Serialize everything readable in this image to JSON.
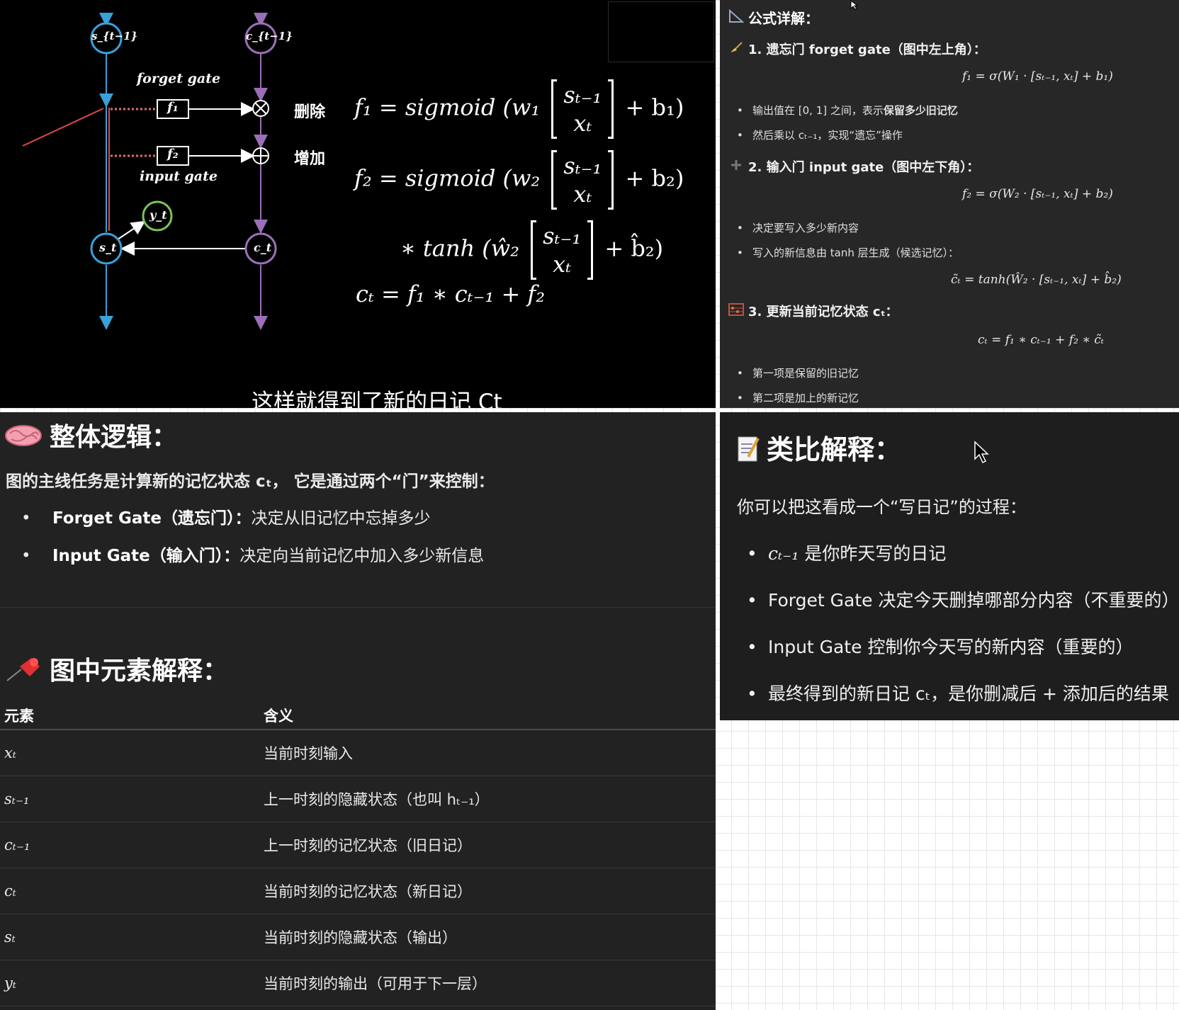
{
  "video": {
    "diagram": {
      "node_s_prev": "s_{t−1}",
      "node_c_prev": "c_{t−1}",
      "node_s": "s_t",
      "node_c": "c_t",
      "node_y": "y_t",
      "box_f1": "f₁",
      "box_f2": "f₂",
      "forget_gate": "forget gate",
      "input_gate": "input gate",
      "op_delete": "删除",
      "op_add": "增加"
    },
    "equations": {
      "eq1_lhs": "f₁ = sigmoid (w₁",
      "eq1_rhs": "+ b₁)",
      "eq2_lhs": "f₂ = sigmoid (w₂",
      "eq2_rhs": "+ b₂)",
      "eq3_lhs": "∗ tanh (ŵ₂",
      "eq3_rhs": "+ b̂₂)",
      "eq4": "cₜ = f₁ ∗ cₜ₋₁ + f₂",
      "mat_top": "sₜ₋₁",
      "mat_bottom": "xₜ"
    },
    "caption": "这样就得到了新的日记 Ct"
  },
  "formula_panel": {
    "title": "公式详解：",
    "title_icon": "triangle-ruler-icon",
    "sec1_icon": "broom-icon",
    "sec1_title": "1. 遗忘门 forget gate（图中左上角）：",
    "sec1_formula": "f₁ = σ(W₁ · [sₜ₋₁, xₜ] + b₁)",
    "sec1_b1_pre": "输出值在 [0, 1] 之间，表示",
    "sec1_b1_bold": "保留多少旧记忆",
    "sec1_b2": "然后乘以 cₜ₋₁，实现“遗忘”操作",
    "sec2_icon": "plus-icon",
    "sec2_title": "2. 输入门 input gate（图中左下角）：",
    "sec2_formula": "f₂ = σ(W₂ · [sₜ₋₁, xₜ] + b₂)",
    "sec2_b1": "决定要写入多少新内容",
    "sec2_b2": "写入的新信息由 tanh 层生成（候选记忆）：",
    "sec2_formula2": "c̃ₜ = tanh(Ŵ₂ · [sₜ₋₁, xₜ] + b̂₂)",
    "sec3_icon": "abacus-icon",
    "sec3_title": "3. 更新当前记忆状态 cₜ：",
    "sec3_formula": "cₜ = f₁ ∗ cₜ₋₁ + f₂ ∗ c̃ₜ",
    "sec3_b1": "第一项是保留的旧记忆",
    "sec3_b2": "第二项是加上的新记忆"
  },
  "logic_panel": {
    "title": "整体逻辑：",
    "title_icon": "brain-icon",
    "intro": "图的主线任务是计算新的记忆状态 cₜ，  它是通过两个“门”来控制：",
    "items": [
      {
        "bold": "Forget Gate（遗忘门）：",
        "text": "决定从旧记忆中忘掉多少"
      },
      {
        "bold": "Input Gate（输入门）：",
        "text": "决定向当前记忆中加入多少新信息"
      }
    ],
    "elements_title": "图中元素解释：",
    "elements_icon": "pushpin-icon",
    "table_header": [
      "元素",
      "含义"
    ],
    "table_rows": [
      {
        "sym": "xₜ",
        "meaning": "当前时刻输入"
      },
      {
        "sym": "sₜ₋₁",
        "meaning": "上一时刻的隐藏状态（也叫 hₜ₋₁）"
      },
      {
        "sym": "cₜ₋₁",
        "meaning": "上一时刻的记忆状态（旧日记）"
      },
      {
        "sym": "cₜ",
        "meaning": "当前时刻的记忆状态（新日记）"
      },
      {
        "sym": "sₜ",
        "meaning": "当前时刻的隐藏状态（输出）"
      },
      {
        "sym": "yₜ",
        "meaning": "当前时刻的输出（可用于下一层）"
      }
    ]
  },
  "analogy_panel": {
    "title": "类比解释：",
    "title_icon": "memo-icon",
    "intro": "你可以把这看成一个“写日记”的过程：",
    "items": [
      {
        "math": "cₜ₋₁",
        "text": " 是你昨天写的日记"
      },
      {
        "math": "",
        "text": "Forget Gate 决定今天删掉哪部分内容（不重要的）"
      },
      {
        "math": "",
        "text": "Input Gate 控制你今天写的新内容（重要的）"
      },
      {
        "math": "",
        "text": "最终得到的新日记 cₜ，是你删减后 + 添加后的结果"
      }
    ]
  },
  "colors": {
    "blue_path": "#3aa0d8",
    "purple_path": "#9a6fb8",
    "green_node": "#7cc35a",
    "red_line": "#e04848"
  }
}
